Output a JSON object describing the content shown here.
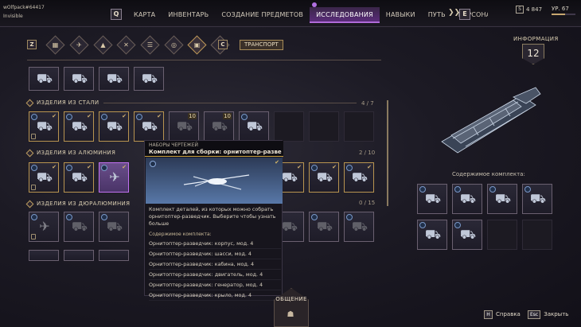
{
  "player": {
    "name": "wOlfpack#64417",
    "status": "Invisible"
  },
  "nav": {
    "left_key": "Q",
    "right_key": "E",
    "tabs": [
      {
        "label": "КАРТА",
        "active": false
      },
      {
        "label": "ИНВЕНТАРЬ",
        "active": false
      },
      {
        "label": "СОЗДАНИЕ ПРЕДМЕТОВ",
        "active": false
      },
      {
        "label": "ИССЛЕДОВАНИЯ",
        "active": true
      },
      {
        "label": "НАВЫКИ",
        "active": false
      },
      {
        "label": "ПУТЬ",
        "active": false
      },
      {
        "label": "ПЕРСОНА",
        "active": false
      }
    ],
    "next_icon": "double-chevron-right-icon"
  },
  "currency": {
    "icon": "solari-icon",
    "amount": "4 847"
  },
  "level": {
    "label": "УР. 67",
    "progress": 0.55
  },
  "filters": {
    "left_key": "Z",
    "right_key": "C",
    "category": "ТРАНСПОРТ",
    "icons": [
      "grid-icon",
      "ornithopter-icon",
      "sandbike-icon",
      "buggy-icon",
      "crawler-icon",
      "treadwheel-icon",
      "tracked-icon",
      "scout-icon"
    ]
  },
  "sections": [
    {
      "title": "ИЗДЕЛИЯ ИЗ СТАЛИ",
      "count": "4 / 7"
    },
    {
      "title": "ИЗДЕЛИЯ ИЗ АЛЮМИНИЯ",
      "count": "2 / 10"
    },
    {
      "title": "ИЗДЕЛИЯ ИЗ ДЮРАЛЮМИНИЯ",
      "count": "0 / 15"
    }
  ],
  "slot_quantity": "10",
  "tooltip": {
    "subtitle": "НАБОРЫ ЧЕРТЕЖЕЙ",
    "title": "Комплект для сборки: орнитоптер-разве",
    "description": "Комплект деталей, из которых можно собрать орнитоптер-разведчик. Выберите чтобы узнать больше",
    "contents_label": "Содержимое комплекта:",
    "items": [
      "Орнитоптер-разведчик: корпус, мод. 4",
      "Орнитоптер-разведчик: шасси, мод. 4",
      "Орнитоптер-разведчик: кабина, мод. 4",
      "Орнитоптер-разведчик: двигатель, мод. 4",
      "Орнитоптер-разведчик: генератор, мод. 4",
      "Орнитоптер-разведчик: крыло, мод. 4"
    ]
  },
  "info": {
    "title": "ИНФОРМАЦИЯ",
    "number": "12",
    "contents_label": "Содержимое комплекта:"
  },
  "bottom": {
    "social_label": "ОБЩЕНИЕ"
  },
  "hints": [
    {
      "key": "H",
      "label": "Справка"
    },
    {
      "key": "Esc",
      "label": "Закрыть"
    }
  ],
  "colors": {
    "accent": "#b06ad8",
    "gold": "#c8a040",
    "selected": "#6a4e8a"
  }
}
